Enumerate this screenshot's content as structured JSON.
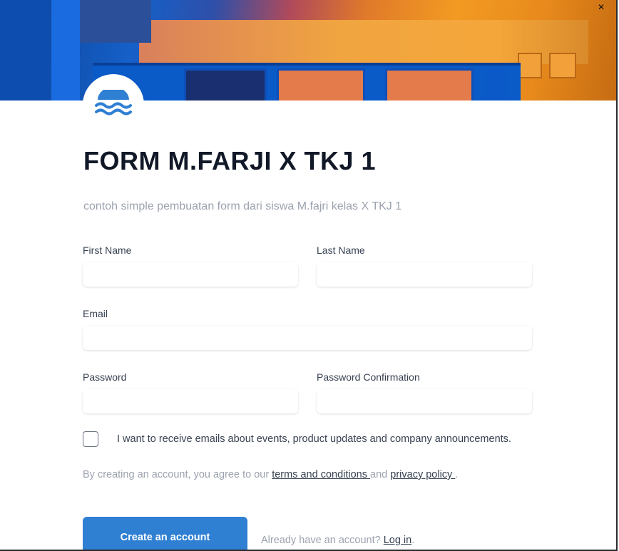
{
  "hero": {
    "alt": "building-photo"
  },
  "form": {
    "title": "FORM M.FARJI X TKJ 1",
    "subtitle": "contoh simple pembuatan form dari siswa M.fajri kelas X TKJ 1",
    "fields": {
      "first_name": {
        "label": "First Name",
        "value": ""
      },
      "last_name": {
        "label": "Last Name",
        "value": ""
      },
      "email": {
        "label": "Email",
        "value": ""
      },
      "password": {
        "label": "Password",
        "value": ""
      },
      "password_confirmation": {
        "label": "Password Confirmation",
        "value": ""
      }
    },
    "marketing_checkbox": {
      "label": "I want to receive emails about events, product updates and company announcements.",
      "checked": false
    },
    "agreement": {
      "prefix": "By creating an account, you agree to our ",
      "terms_link": "terms and conditions ",
      "middle": "and ",
      "privacy_link": "privacy policy ",
      "suffix": "."
    },
    "submit_label": "Create an account",
    "login_prompt": {
      "prefix": "Already have an account? ",
      "link": "Log in",
      "suffix": "."
    }
  },
  "colors": {
    "accent": "#2f7fd3",
    "logo": "#2f7fd3",
    "muted_text": "#9ca3af",
    "title_text": "#111827"
  },
  "icons": {
    "logo": "waves-logo-icon"
  }
}
